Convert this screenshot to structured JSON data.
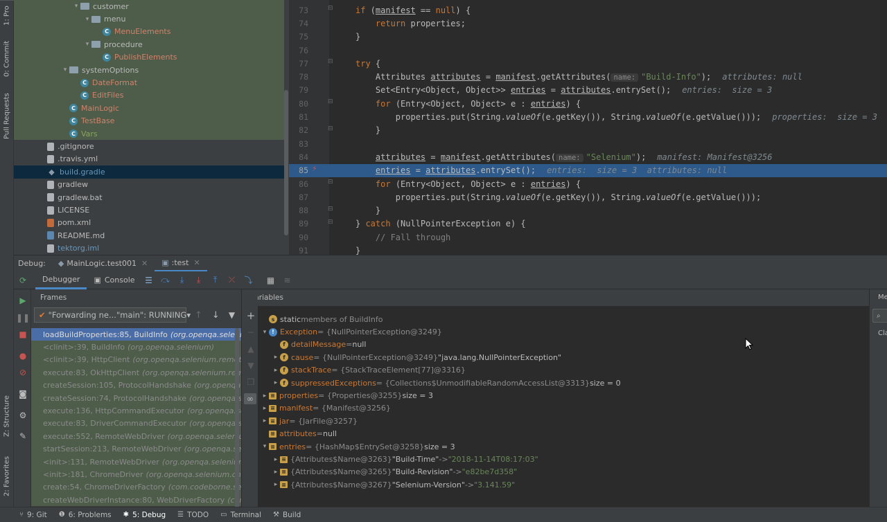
{
  "left_strip": {
    "tabs": [
      "1: Pro",
      "0: Commit",
      "Pull Requests",
      "Z: Structure",
      "2: Favorites"
    ]
  },
  "project_tree": [
    {
      "indent": 5,
      "arrow": "▾",
      "icon": "folder",
      "label": "customer",
      "color": "plain",
      "bg": "green"
    },
    {
      "indent": 6,
      "arrow": "▾",
      "icon": "folder",
      "label": "menu",
      "color": "plain",
      "bg": "green"
    },
    {
      "indent": 7,
      "arrow": "",
      "icon": "class",
      "label": "MenuElements",
      "color": "red",
      "bg": "green"
    },
    {
      "indent": 6,
      "arrow": "▾",
      "icon": "folder",
      "label": "procedure",
      "color": "plain",
      "bg": "green"
    },
    {
      "indent": 7,
      "arrow": "",
      "icon": "class",
      "label": "PublishElements",
      "color": "red",
      "bg": "green"
    },
    {
      "indent": 4,
      "arrow": "▾",
      "icon": "folder",
      "label": "systemOptions",
      "color": "plain",
      "bg": "green"
    },
    {
      "indent": 5,
      "arrow": "",
      "icon": "class",
      "label": "DateFormat",
      "color": "red",
      "bg": "green"
    },
    {
      "indent": 5,
      "arrow": "",
      "icon": "class",
      "label": "EditFiles",
      "color": "red",
      "bg": "green"
    },
    {
      "indent": 4,
      "arrow": "",
      "icon": "class",
      "label": "MainLogic",
      "color": "red",
      "bg": "green"
    },
    {
      "indent": 4,
      "arrow": "",
      "icon": "class",
      "label": "TestBase",
      "color": "red",
      "bg": "green"
    },
    {
      "indent": 4,
      "arrow": "",
      "icon": "class",
      "label": "Vars",
      "color": "greenc",
      "bg": "green"
    },
    {
      "indent": 2,
      "arrow": "",
      "icon": "doc",
      "label": ".gitignore",
      "color": "plain",
      "bg": ""
    },
    {
      "indent": 2,
      "arrow": "",
      "icon": "doc",
      "label": ".travis.yml",
      "color": "plain",
      "bg": ""
    },
    {
      "indent": 2,
      "arrow": "",
      "icon": "gradle",
      "label": "build.gradle",
      "color": "blue",
      "bg": "sel"
    },
    {
      "indent": 2,
      "arrow": "",
      "icon": "doc",
      "label": "gradlew",
      "color": "plain",
      "bg": ""
    },
    {
      "indent": 2,
      "arrow": "",
      "icon": "doc",
      "label": "gradlew.bat",
      "color": "plain",
      "bg": ""
    },
    {
      "indent": 2,
      "arrow": "",
      "icon": "doc",
      "label": "LICENSE",
      "color": "plain",
      "bg": ""
    },
    {
      "indent": 2,
      "arrow": "",
      "icon": "xml",
      "label": "pom.xml",
      "color": "plain",
      "bg": ""
    },
    {
      "indent": 2,
      "arrow": "",
      "icon": "md",
      "label": "README.md",
      "color": "plain",
      "bg": ""
    },
    {
      "indent": 2,
      "arrow": "",
      "icon": "iml",
      "label": "tektorg.iml",
      "color": "blue",
      "bg": ""
    }
  ],
  "editor": {
    "current_line": 85,
    "lines": [
      {
        "n": 73,
        "html": "<span style='padding-left:0'></span><span class='kw'>if</span> (<span class='ul'>manifest</span> == <span class='kw'>null</span>) {"
      },
      {
        "n": 74,
        "html": "  <span class='kw'>return</span> properties;"
      },
      {
        "n": 75,
        "html": "}"
      },
      {
        "n": 76,
        "html": ""
      },
      {
        "n": 77,
        "html": "<span class='kw'>try</span> {"
      },
      {
        "n": 78,
        "html": "  Attributes <span class='ul'>attributes</span> = <span class='ul'>manifest</span>.getAttributes(<span class='pn'>name:</span><span class='str'>\"Build-Info\"</span>);<span class='hint'>attributes: null</span>"
      },
      {
        "n": 79,
        "html": "  Set&lt;Entry&lt;Object, Object&gt;&gt; <span class='ul'>entries</span> = <span class='ul'>attributes</span>.entrySet();<span class='hint'>entries:  size = 3</span>"
      },
      {
        "n": 80,
        "html": "  <span class='kw'>for</span> (Entry&lt;Object, Object&gt; e : <span class='ul'>entries</span>) {"
      },
      {
        "n": 81,
        "html": "    properties.put(String.<span class='it'>valueOf</span>(e.getKey()), String.<span class='it'>valueOf</span>(e.getValue()));<span class='hint'>properties:  size = 3</span>"
      },
      {
        "n": 82,
        "html": "  }"
      },
      {
        "n": 83,
        "html": ""
      },
      {
        "n": 84,
        "html": "  <span class='ul'>attributes</span> = <span class='ul'>manifest</span>.getAttributes(<span class='pn'>name:</span><span class='str'>\"Selenium\"</span>);<span class='hint'>manifest: Manifest@3256</span>"
      },
      {
        "n": 85,
        "html": "  <span class='ul'>entries</span> = <span class='ul'>attributes</span>.entrySet();<span class='hint'>entries:  size = 3  attributes: null</span>"
      },
      {
        "n": 86,
        "html": "  <span class='kw'>for</span> (Entry&lt;Object, Object&gt; e : <span class='ul'>entries</span>) {"
      },
      {
        "n": 87,
        "html": "    properties.put(String.<span class='it'>valueOf</span>(e.getKey()), String.<span class='it'>valueOf</span>(e.getValue()));"
      },
      {
        "n": 88,
        "html": "  }"
      },
      {
        "n": 89,
        "html": "} <span class='kw'>catch</span> (NullPointerException e) {"
      },
      {
        "n": 90,
        "html": "  <span class='cm'>// Fall through</span>"
      },
      {
        "n": 91,
        "html": "}"
      }
    ]
  },
  "debug": {
    "label": "Debug:",
    "tabs": [
      {
        "label": "MainLogic.test001",
        "active": false
      },
      {
        "label": ":test",
        "active": true
      }
    ],
    "subtabs": {
      "debugger": "Debugger",
      "console": "Console"
    },
    "frames_title": "Frames",
    "thread": "\"Forwarding ne...\"main\": RUNNING",
    "frames": [
      {
        "method": "loadBuildProperties:85, BuildInfo",
        "pkg": "(org.openqa.selenium)",
        "sel": true
      },
      {
        "method": "<clinit>:39, BuildInfo",
        "pkg": "(org.openqa.selenium)",
        "sel": false
      },
      {
        "method": "<clinit>:39, HttpClient",
        "pkg": "(org.openqa.selenium.remote.http)",
        "sel": false
      },
      {
        "method": "execute:83, OkHttpClient",
        "pkg": "(org.openqa.selenium.remote.inter",
        "sel": false
      },
      {
        "method": "createSession:105, ProtocolHandshake",
        "pkg": "(org.openqa.seleniu",
        "sel": false
      },
      {
        "method": "createSession:74, ProtocolHandshake",
        "pkg": "(org.openqa.selenium",
        "sel": false
      },
      {
        "method": "execute:136, HttpCommandExecutor",
        "pkg": "(org.openqa.selenium.",
        "sel": false
      },
      {
        "method": "execute:83, DriverCommandExecutor",
        "pkg": "(org.openqa.selenium",
        "sel": false
      },
      {
        "method": "execute:552, RemoteWebDriver",
        "pkg": "(org.openqa.selenium.remo",
        "sel": false
      },
      {
        "method": "startSession:213, RemoteWebDriver",
        "pkg": "(org.openqa.selenium.r",
        "sel": false
      },
      {
        "method": "<init>:131, RemoteWebDriver",
        "pkg": "(org.openqa.selenium.remot",
        "sel": false
      },
      {
        "method": "<init>:181, ChromeDriver",
        "pkg": "(org.openqa.selenium.chrome)",
        "sel": false
      },
      {
        "method": "create:54, ChromeDriverFactory",
        "pkg": "(com.codeborne.selenide.w",
        "sel": false
      },
      {
        "method": "createWebDriverInstance:80, WebDriverFactory",
        "pkg": "(com.codeb",
        "sel": false
      }
    ],
    "variables_title": "Variables",
    "memory_tab": "Me",
    "memory_class": "Clas",
    "variables": [
      {
        "indent": 0,
        "arrow": "",
        "icon": "s",
        "name": "static",
        "rest": " members of BuildInfo",
        "namecolor": "plain",
        "val": "",
        "valcolor": ""
      },
      {
        "indent": 0,
        "arrow": "▾",
        "icon": "exc",
        "name": "Exception",
        "rest": " = {NullPointerException@3249}",
        "namecolor": "orange",
        "val": "",
        "valcolor": ""
      },
      {
        "indent": 1,
        "arrow": "",
        "icon": "f",
        "name": "detailMessage",
        "rest": " = ",
        "namecolor": "orange",
        "val": "null",
        "valcolor": "plain"
      },
      {
        "indent": 1,
        "arrow": "▸",
        "icon": "f",
        "name": "cause",
        "rest": " = {NullPointerException@3249} ",
        "namecolor": "orange",
        "val": "\"java.lang.NullPointerException\"",
        "valcolor": "plain"
      },
      {
        "indent": 1,
        "arrow": "▸",
        "icon": "f",
        "name": "stackTrace",
        "rest": " = {StackTraceElement[77]@3316}",
        "namecolor": "orange",
        "val": "",
        "valcolor": ""
      },
      {
        "indent": 1,
        "arrow": "▸",
        "icon": "f",
        "name": "suppressedExceptions",
        "rest": " = {Collections$UnmodifiableRandomAccessList@3313} ",
        "namecolor": "orange",
        "val": " size = 0",
        "valcolor": "plain"
      },
      {
        "indent": 0,
        "arrow": "▸",
        "icon": "stack",
        "name": "properties",
        "rest": " = {Properties@3255} ",
        "namecolor": "orange",
        "val": " size = 3",
        "valcolor": "plain"
      },
      {
        "indent": 0,
        "arrow": "▸",
        "icon": "stack",
        "name": "manifest",
        "rest": " = {Manifest@3256}",
        "namecolor": "orange",
        "val": "",
        "valcolor": ""
      },
      {
        "indent": 0,
        "arrow": "▸",
        "icon": "stack",
        "name": "jar",
        "rest": " = {JarFile@3257}",
        "namecolor": "orange",
        "val": "",
        "valcolor": ""
      },
      {
        "indent": 0,
        "arrow": "",
        "icon": "stack",
        "name": "attributes",
        "rest": " = ",
        "namecolor": "orange",
        "val": "null",
        "valcolor": "plain"
      },
      {
        "indent": 0,
        "arrow": "▾",
        "icon": "stack",
        "name": "entries",
        "rest": " = {HashMap$EntrySet@3258} ",
        "namecolor": "orange",
        "val": " size = 3",
        "valcolor": "plain"
      },
      {
        "indent": 1,
        "arrow": "▸",
        "icon": "stack",
        "name": "",
        "rest": "{Attributes$Name@3263} ",
        "namecolor": "plain",
        "val": "\"Build-Time\"",
        "valcolor": "plain",
        "arrowtxt": " -> ",
        "val2": "\"2018-11-14T08:17:03\""
      },
      {
        "indent": 1,
        "arrow": "▸",
        "icon": "stack",
        "name": "",
        "rest": "{Attributes$Name@3265} ",
        "namecolor": "plain",
        "val": "\"Build-Revision\"",
        "valcolor": "plain",
        "arrowtxt": " -> ",
        "val2": "\"e82be7d358\""
      },
      {
        "indent": 1,
        "arrow": "▸",
        "icon": "stack",
        "name": "",
        "rest": "{Attributes$Name@3267} ",
        "namecolor": "plain",
        "val": "\"Selenium-Version\"",
        "valcolor": "plain",
        "arrowtxt": " -> ",
        "val2": "\"3.141.59\""
      }
    ]
  },
  "statusbar": [
    {
      "icon": "git-icon",
      "glyph": "⑂",
      "label": "9: Git",
      "active": false
    },
    {
      "icon": "problems-icon",
      "glyph": "❶",
      "label": "6: Problems",
      "active": false
    },
    {
      "icon": "debug-icon",
      "glyph": "✱",
      "label": "5: Debug",
      "active": true
    },
    {
      "icon": "todo-icon",
      "glyph": "☰",
      "label": "TODO",
      "active": false
    },
    {
      "icon": "terminal-icon",
      "glyph": "▭",
      "label": "Terminal",
      "active": false
    },
    {
      "icon": "build-icon",
      "glyph": "⚒",
      "label": "Build",
      "active": false
    }
  ],
  "colors": {
    "accent": "#4a88c7",
    "current_line": "#2d5a8a",
    "selection_tree": "#0d293e",
    "highlight_green": "#4e5c4a"
  }
}
